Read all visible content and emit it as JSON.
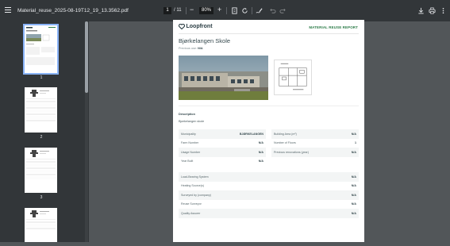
{
  "toolbar": {
    "filename": "Material_reuse_2025-08-19T12_19_13.3562.pdf",
    "current_page": "1",
    "page_separator": "/ 11",
    "zoom": "80%"
  },
  "sidebar": {
    "thumbnails": [
      {
        "number": "1",
        "selected": true
      },
      {
        "number": "2",
        "selected": false
      },
      {
        "number": "3",
        "selected": false
      },
      {
        "number": "",
        "selected": false
      }
    ]
  },
  "report": {
    "logo_text": "Loopfront",
    "header_title": "MATERIAL REUSE REPORT",
    "building_name": "Bjørkelangen Skole",
    "previous_use_label": "Previous use:",
    "previous_use_value": "N/A",
    "description_label": "Description",
    "description_value": "Bjørkelangen skole",
    "left_table": [
      {
        "label": "Municipality",
        "value": "BJØRKELANGEN"
      },
      {
        "label": "Farm Number",
        "value": "N/A"
      },
      {
        "label": "Usage Number",
        "value": "N/A"
      },
      {
        "label": "Year Built",
        "value": "N/A"
      }
    ],
    "right_table": [
      {
        "label": "Building Area (m²)",
        "value": "N/A"
      },
      {
        "label": "Number of Floors",
        "value": "1"
      },
      {
        "label": "Previous renovations (year)",
        "value": "N/A"
      }
    ],
    "full_table": [
      {
        "label": "Load-Bearing System",
        "value": "N/A"
      },
      {
        "label": "Heating Source(s)",
        "value": "N/A"
      },
      {
        "label": "Surveyed by (company)",
        "value": "N/A"
      },
      {
        "label": "Reuse Surveyor",
        "value": "N/A"
      },
      {
        "label": "Quality Assurer",
        "value": "N/A"
      }
    ]
  },
  "colors": {
    "toolbar_bg": "#323639",
    "viewer_bg": "#525659",
    "selected_outline": "#8ab4f8",
    "brand_green": "#2e7d4a"
  }
}
